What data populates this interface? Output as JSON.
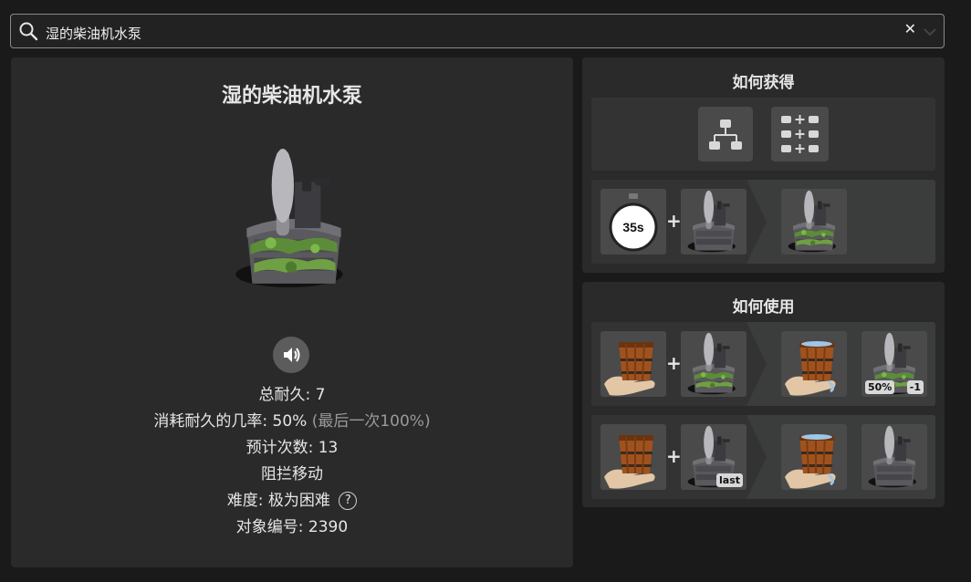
{
  "search": {
    "value": "湿的柴油机水泵"
  },
  "item": {
    "title": "湿的柴油机水泵",
    "stats": {
      "durability": "总耐久: 7",
      "use_chance": "消耗耐久的几率: 50%",
      "use_chance_note": "(最后一次100%)",
      "estimated_uses": "预计次数: 13",
      "blocks": "阻拦移动",
      "difficulty": "难度: 极为困难",
      "help": "?",
      "object_id": "对象编号: 2390"
    }
  },
  "obtain": {
    "title": "如何获得",
    "timer": "35s"
  },
  "usage": {
    "title": "如何使用",
    "row1_badge_chance": "50%",
    "row1_badge_delta": "-1",
    "row2_badge_last": "last"
  },
  "icons": [
    "search-icon",
    "close-icon",
    "chevron-down-icon",
    "speaker-icon",
    "tree-icon",
    "grid-plus-icon",
    "timer-icon",
    "hand-bucket-icon",
    "pump-icon"
  ],
  "colors": {
    "background": "#1a1a1a",
    "panel": "#2a2a2a",
    "slot": "#4a4a4a",
    "moss": "#5c8c3a"
  }
}
